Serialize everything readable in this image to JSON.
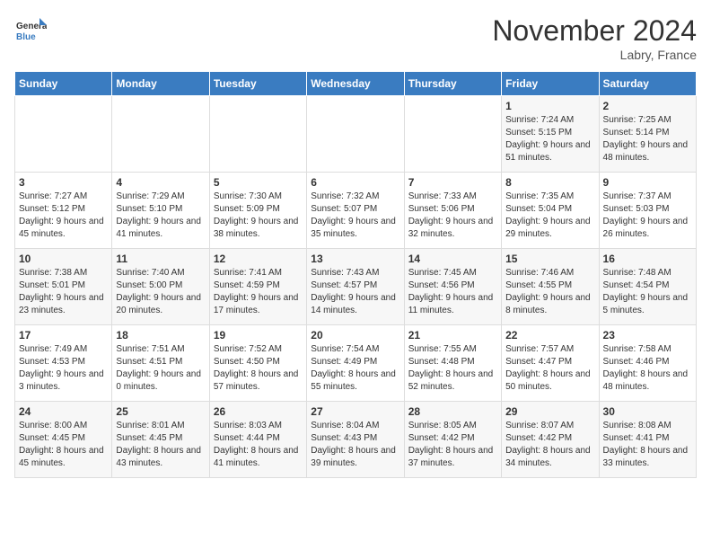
{
  "header": {
    "logo_general": "General",
    "logo_blue": "Blue",
    "month_title": "November 2024",
    "location": "Labry, France"
  },
  "days_of_week": [
    "Sunday",
    "Monday",
    "Tuesday",
    "Wednesday",
    "Thursday",
    "Friday",
    "Saturday"
  ],
  "weeks": [
    [
      {
        "day": "",
        "info": ""
      },
      {
        "day": "",
        "info": ""
      },
      {
        "day": "",
        "info": ""
      },
      {
        "day": "",
        "info": ""
      },
      {
        "day": "",
        "info": ""
      },
      {
        "day": "1",
        "info": "Sunrise: 7:24 AM\nSunset: 5:15 PM\nDaylight: 9 hours and 51 minutes."
      },
      {
        "day": "2",
        "info": "Sunrise: 7:25 AM\nSunset: 5:14 PM\nDaylight: 9 hours and 48 minutes."
      }
    ],
    [
      {
        "day": "3",
        "info": "Sunrise: 7:27 AM\nSunset: 5:12 PM\nDaylight: 9 hours and 45 minutes."
      },
      {
        "day": "4",
        "info": "Sunrise: 7:29 AM\nSunset: 5:10 PM\nDaylight: 9 hours and 41 minutes."
      },
      {
        "day": "5",
        "info": "Sunrise: 7:30 AM\nSunset: 5:09 PM\nDaylight: 9 hours and 38 minutes."
      },
      {
        "day": "6",
        "info": "Sunrise: 7:32 AM\nSunset: 5:07 PM\nDaylight: 9 hours and 35 minutes."
      },
      {
        "day": "7",
        "info": "Sunrise: 7:33 AM\nSunset: 5:06 PM\nDaylight: 9 hours and 32 minutes."
      },
      {
        "day": "8",
        "info": "Sunrise: 7:35 AM\nSunset: 5:04 PM\nDaylight: 9 hours and 29 minutes."
      },
      {
        "day": "9",
        "info": "Sunrise: 7:37 AM\nSunset: 5:03 PM\nDaylight: 9 hours and 26 minutes."
      }
    ],
    [
      {
        "day": "10",
        "info": "Sunrise: 7:38 AM\nSunset: 5:01 PM\nDaylight: 9 hours and 23 minutes."
      },
      {
        "day": "11",
        "info": "Sunrise: 7:40 AM\nSunset: 5:00 PM\nDaylight: 9 hours and 20 minutes."
      },
      {
        "day": "12",
        "info": "Sunrise: 7:41 AM\nSunset: 4:59 PM\nDaylight: 9 hours and 17 minutes."
      },
      {
        "day": "13",
        "info": "Sunrise: 7:43 AM\nSunset: 4:57 PM\nDaylight: 9 hours and 14 minutes."
      },
      {
        "day": "14",
        "info": "Sunrise: 7:45 AM\nSunset: 4:56 PM\nDaylight: 9 hours and 11 minutes."
      },
      {
        "day": "15",
        "info": "Sunrise: 7:46 AM\nSunset: 4:55 PM\nDaylight: 9 hours and 8 minutes."
      },
      {
        "day": "16",
        "info": "Sunrise: 7:48 AM\nSunset: 4:54 PM\nDaylight: 9 hours and 5 minutes."
      }
    ],
    [
      {
        "day": "17",
        "info": "Sunrise: 7:49 AM\nSunset: 4:53 PM\nDaylight: 9 hours and 3 minutes."
      },
      {
        "day": "18",
        "info": "Sunrise: 7:51 AM\nSunset: 4:51 PM\nDaylight: 9 hours and 0 minutes."
      },
      {
        "day": "19",
        "info": "Sunrise: 7:52 AM\nSunset: 4:50 PM\nDaylight: 8 hours and 57 minutes."
      },
      {
        "day": "20",
        "info": "Sunrise: 7:54 AM\nSunset: 4:49 PM\nDaylight: 8 hours and 55 minutes."
      },
      {
        "day": "21",
        "info": "Sunrise: 7:55 AM\nSunset: 4:48 PM\nDaylight: 8 hours and 52 minutes."
      },
      {
        "day": "22",
        "info": "Sunrise: 7:57 AM\nSunset: 4:47 PM\nDaylight: 8 hours and 50 minutes."
      },
      {
        "day": "23",
        "info": "Sunrise: 7:58 AM\nSunset: 4:46 PM\nDaylight: 8 hours and 48 minutes."
      }
    ],
    [
      {
        "day": "24",
        "info": "Sunrise: 8:00 AM\nSunset: 4:45 PM\nDaylight: 8 hours and 45 minutes."
      },
      {
        "day": "25",
        "info": "Sunrise: 8:01 AM\nSunset: 4:45 PM\nDaylight: 8 hours and 43 minutes."
      },
      {
        "day": "26",
        "info": "Sunrise: 8:03 AM\nSunset: 4:44 PM\nDaylight: 8 hours and 41 minutes."
      },
      {
        "day": "27",
        "info": "Sunrise: 8:04 AM\nSunset: 4:43 PM\nDaylight: 8 hours and 39 minutes."
      },
      {
        "day": "28",
        "info": "Sunrise: 8:05 AM\nSunset: 4:42 PM\nDaylight: 8 hours and 37 minutes."
      },
      {
        "day": "29",
        "info": "Sunrise: 8:07 AM\nSunset: 4:42 PM\nDaylight: 8 hours and 34 minutes."
      },
      {
        "day": "30",
        "info": "Sunrise: 8:08 AM\nSunset: 4:41 PM\nDaylight: 8 hours and 33 minutes."
      }
    ]
  ]
}
